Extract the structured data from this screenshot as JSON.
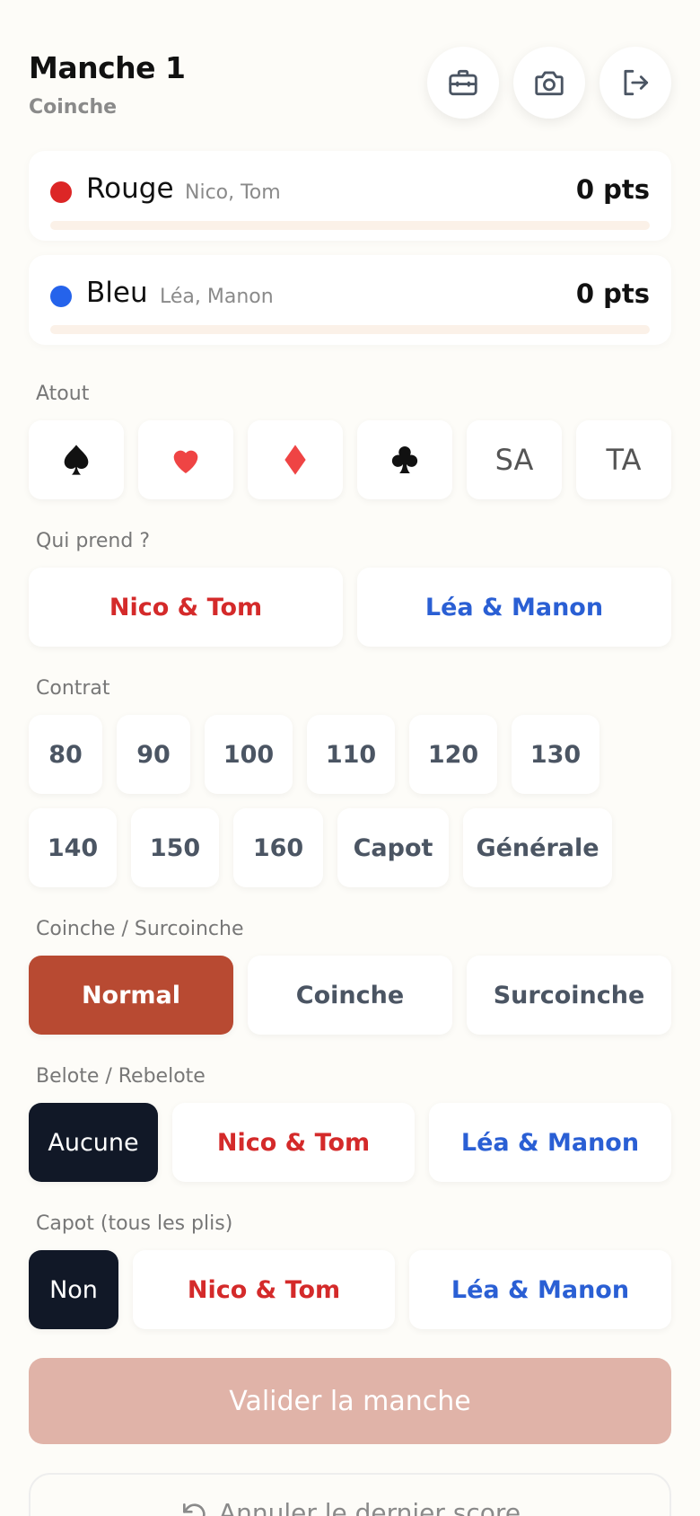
{
  "header": {
    "title": "Manche 1",
    "subtitle": "Coinche"
  },
  "icons": {
    "toolbox": "toolbox-icon",
    "camera": "camera-icon",
    "exit": "exit-icon"
  },
  "teams": [
    {
      "name": "Rouge",
      "players": "Nico, Tom",
      "points": "0 pts",
      "color": "#dc2626"
    },
    {
      "name": "Bleu",
      "players": "Léa, Manon",
      "points": "0 pts",
      "color": "#2563eb"
    }
  ],
  "atout": {
    "label": "Atout",
    "options": [
      "spade",
      "heart",
      "diamond",
      "club",
      "SA",
      "TA"
    ]
  },
  "qui_prend": {
    "label": "Qui prend ?",
    "options": [
      "Nico & Tom",
      "Léa & Manon"
    ]
  },
  "contrat": {
    "label": "Contrat",
    "options": [
      "80",
      "90",
      "100",
      "110",
      "120",
      "130",
      "140",
      "150",
      "160",
      "Capot",
      "Générale"
    ]
  },
  "coinche": {
    "label": "Coinche / Surcoinche",
    "options": [
      "Normal",
      "Coinche",
      "Surcoinche"
    ],
    "selected": "Normal"
  },
  "belote": {
    "label": "Belote / Rebelote",
    "options": [
      "Aucune",
      "Nico & Tom",
      "Léa & Manon"
    ],
    "selected": "Aucune"
  },
  "capot": {
    "label": "Capot (tous les plis)",
    "options": [
      "Non",
      "Nico & Tom",
      "Léa & Manon"
    ],
    "selected": "Non"
  },
  "actions": {
    "validate": "Valider la manche",
    "undo": "Annuler le dernier score"
  },
  "colors": {
    "accent": "#b84a32",
    "red_team": "#d42a2a",
    "blue_team": "#2a5fd4",
    "validate_disabled": "#e0b3a8"
  }
}
